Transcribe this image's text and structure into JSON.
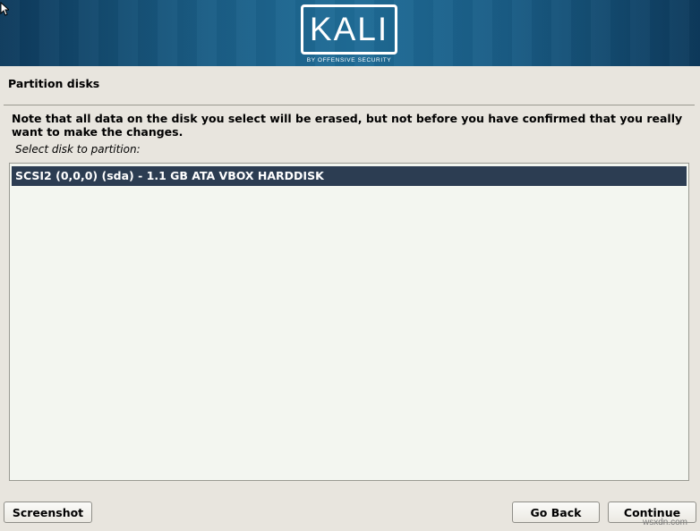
{
  "banner": {
    "logo_text": "KALI",
    "logo_subtitle": "BY OFFENSIVE SECURITY"
  },
  "page": {
    "title": "Partition disks",
    "note": "Note that all data on the disk you select will be erased, but not before you have confirmed that you really want to make the changes.",
    "prompt": "Select disk to partition:"
  },
  "disks": [
    {
      "label": "SCSI2 (0,0,0) (sda) - 1.1 GB ATA VBOX HARDDISK",
      "selected": true
    }
  ],
  "buttons": {
    "screenshot": "Screenshot",
    "go_back": "Go Back",
    "continue": "Continue"
  },
  "watermark": "wsxdn.com",
  "colors": {
    "banner_blue": "#1b5e86",
    "selection": "#2c3d52",
    "background": "#e8e5de"
  }
}
